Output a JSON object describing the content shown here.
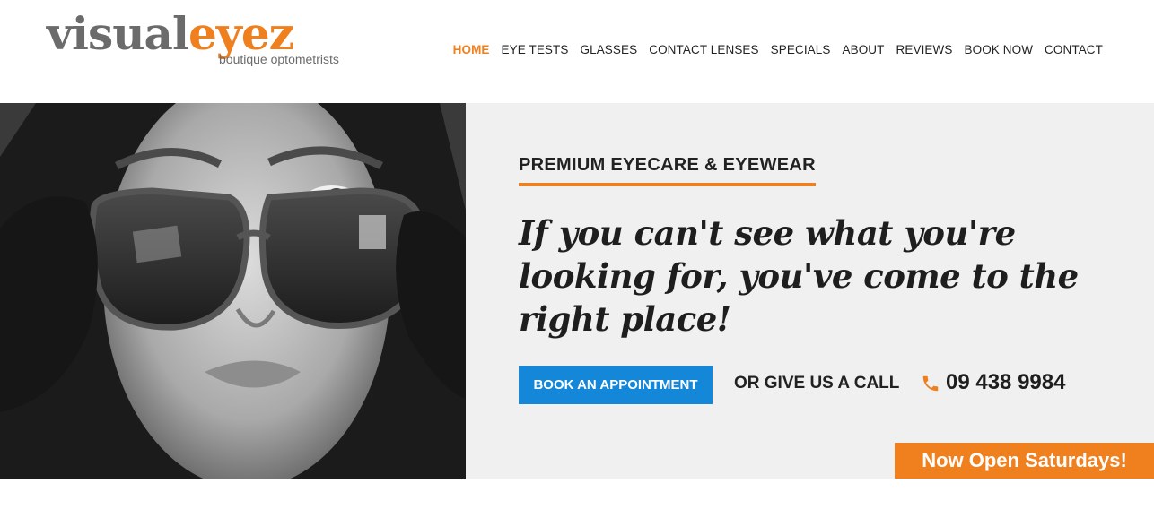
{
  "brand": {
    "logo_part1": "visual",
    "logo_part2": "eyez",
    "tagline": "boutique optometrists",
    "accent_color": "#f07f1e",
    "grey_color": "#6b6b6b"
  },
  "nav": {
    "items": [
      {
        "label": "HOME",
        "active": true
      },
      {
        "label": "EYE TESTS",
        "active": false
      },
      {
        "label": "GLASSES",
        "active": false
      },
      {
        "label": "CONTACT LENSES",
        "active": false
      },
      {
        "label": "SPECIALS",
        "active": false
      },
      {
        "label": "ABOUT",
        "active": false
      },
      {
        "label": "REVIEWS",
        "active": false
      },
      {
        "label": "BOOK NOW",
        "active": false
      },
      {
        "label": "CONTACT",
        "active": false
      }
    ]
  },
  "hero": {
    "eyebrow": "PREMIUM EYECARE & EYEWEAR",
    "headline": "If you can't see what you're looking for, you've come to the right place!",
    "book_button": "BOOK AN APPOINTMENT",
    "call_text": "OR GIVE US A CALL",
    "phone_icon": "phone-icon",
    "phone": "09 438 9984",
    "badge": "Now Open Saturdays!",
    "button_color": "#1487d8",
    "background_color": "#f0f0f0"
  }
}
